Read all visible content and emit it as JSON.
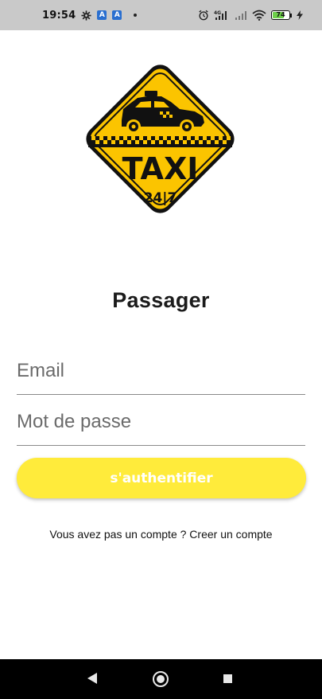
{
  "status_bar": {
    "time": "19:54",
    "app_badge_1": "A",
    "app_badge_2": "A",
    "network_label": "4G",
    "battery_level": "74",
    "battery_percent": 74,
    "colors": {
      "background": "#c9c9c9",
      "battery_fill": "#6ed04a"
    }
  },
  "logo": {
    "text": "TAXI",
    "subtext": "24|7",
    "icon": "taxi-logo-icon"
  },
  "page": {
    "title": "Passager"
  },
  "form": {
    "email_placeholder": "Email",
    "password_placeholder": "Mot de passe",
    "submit_label": "s'authentifier",
    "accent_color": "#ffeb3b"
  },
  "signup": {
    "text": "Vous avez pas un compte ? Creer un compte"
  },
  "nav_bar": {
    "icons": [
      "back-icon",
      "home-icon",
      "recents-icon"
    ]
  }
}
